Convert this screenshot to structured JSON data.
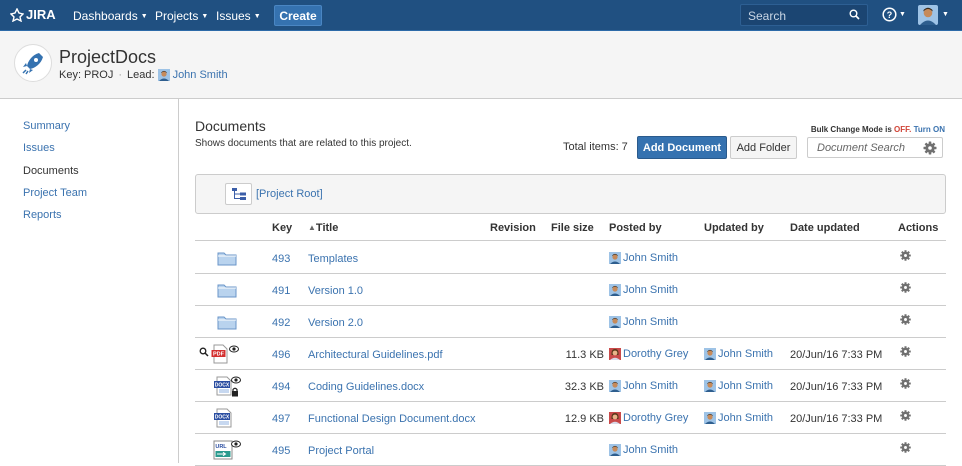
{
  "topnav": {
    "logo": "JIRA",
    "menus": [
      "Dashboards",
      "Projects",
      "Issues"
    ],
    "create_label": "Create",
    "search_placeholder": "Search"
  },
  "project": {
    "name": "ProjectDocs",
    "key_label": "Key:",
    "key": "PROJ",
    "lead_label": "Lead:",
    "lead": "John Smith"
  },
  "sidebar": {
    "items": [
      {
        "label": "Summary",
        "active": false
      },
      {
        "label": "Issues",
        "active": false
      },
      {
        "label": "Documents",
        "active": true
      },
      {
        "label": "Project Team",
        "active": false
      },
      {
        "label": "Reports",
        "active": false
      }
    ]
  },
  "documents": {
    "title": "Documents",
    "subtitle": "Shows documents that are related to this project.",
    "bulk_prefix": "Bulk Change Mode is",
    "bulk_state": "OFF.",
    "bulk_toggle": "Turn ON",
    "total_label": "Total items: 7",
    "add_document": "Add Document",
    "add_folder": "Add Folder",
    "search_placeholder": "Document Search",
    "root_link": "[Project Root]"
  },
  "table": {
    "columns": [
      "Key",
      "Title",
      "Revision",
      "File size",
      "Posted by",
      "Updated by",
      "Date updated",
      "Actions"
    ],
    "rows": [
      {
        "type": "folder",
        "key": "493",
        "title": "Templates",
        "revision": "",
        "size": "",
        "posted": "John Smith",
        "posted_avatar": "male",
        "updated": "",
        "updated_avatar": "",
        "date": ""
      },
      {
        "type": "folder",
        "key": "491",
        "title": "Version 1.0",
        "revision": "",
        "size": "",
        "posted": "John Smith",
        "posted_avatar": "male",
        "updated": "",
        "updated_avatar": "",
        "date": ""
      },
      {
        "type": "folder",
        "key": "492",
        "title": "Version 2.0",
        "revision": "",
        "size": "",
        "posted": "John Smith",
        "posted_avatar": "male",
        "updated": "",
        "updated_avatar": "",
        "date": ""
      },
      {
        "type": "pdf",
        "key": "496",
        "title": "Architectural Guidelines.pdf",
        "revision": "",
        "size": "11.3 KB",
        "posted": "Dorothy Grey",
        "posted_avatar": "female",
        "updated": "John Smith",
        "updated_avatar": "male",
        "date": "20/Jun/16 7:33 PM"
      },
      {
        "type": "docx-locked",
        "key": "494",
        "title": "Coding Guidelines.docx",
        "revision": "",
        "size": "32.3 KB",
        "posted": "John Smith",
        "posted_avatar": "male",
        "updated": "John Smith",
        "updated_avatar": "male",
        "date": "20/Jun/16 7:33 PM"
      },
      {
        "type": "docx",
        "key": "497",
        "title": "Functional Design Document.docx",
        "revision": "",
        "size": "12.9 KB",
        "posted": "Dorothy Grey",
        "posted_avatar": "female",
        "updated": "John Smith",
        "updated_avatar": "male",
        "date": "20/Jun/16 7:33 PM"
      },
      {
        "type": "url",
        "key": "495",
        "title": "Project Portal",
        "revision": "",
        "size": "",
        "posted": "John Smith",
        "posted_avatar": "male",
        "updated": "",
        "updated_avatar": "",
        "date": ""
      }
    ]
  },
  "colors": {
    "nav": "#205081",
    "link": "#3b73af",
    "primary": "#3572b0",
    "off": "#d04437"
  }
}
